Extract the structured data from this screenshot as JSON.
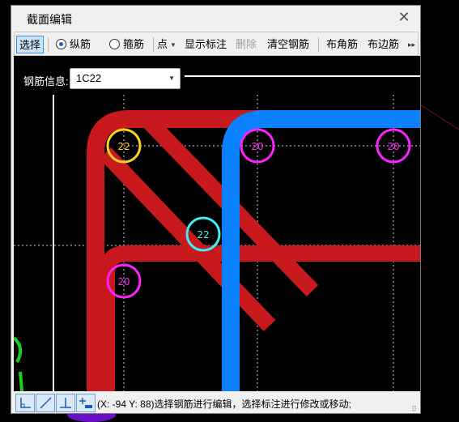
{
  "window": {
    "title": "截面编辑",
    "close_icon": "close-icon"
  },
  "toolbar": {
    "select": "选择",
    "radio_longitudinal": "纵筋",
    "radio_stirrup": "箍筋",
    "point": "点",
    "show_label": "显示标注",
    "delete": "删除",
    "clear_rebar": "清空钢筋",
    "corner_rebar": "布角筋",
    "side_rebar": "布边筋",
    "more": "▸▸"
  },
  "rebar_info": {
    "label": "钢筋信息:",
    "value": "1C22"
  },
  "bars": [
    {
      "label": "22",
      "color": "#ffd21f"
    },
    {
      "label": "20",
      "color": "#ff1fff"
    },
    {
      "label": "20",
      "color": "#ff1fff"
    },
    {
      "label": "22",
      "color": "#3ef0f0"
    },
    {
      "label": "20",
      "color": "#ff1fff"
    }
  ],
  "colors": {
    "stirrup_red": "#c8191e",
    "stirrup_blue": "#0a82ff",
    "accent": "#3d8ee0"
  },
  "status": {
    "text": "(X: -94 Y: 88)选择钢筋进行编辑，选择标注进行修改或移动;"
  }
}
